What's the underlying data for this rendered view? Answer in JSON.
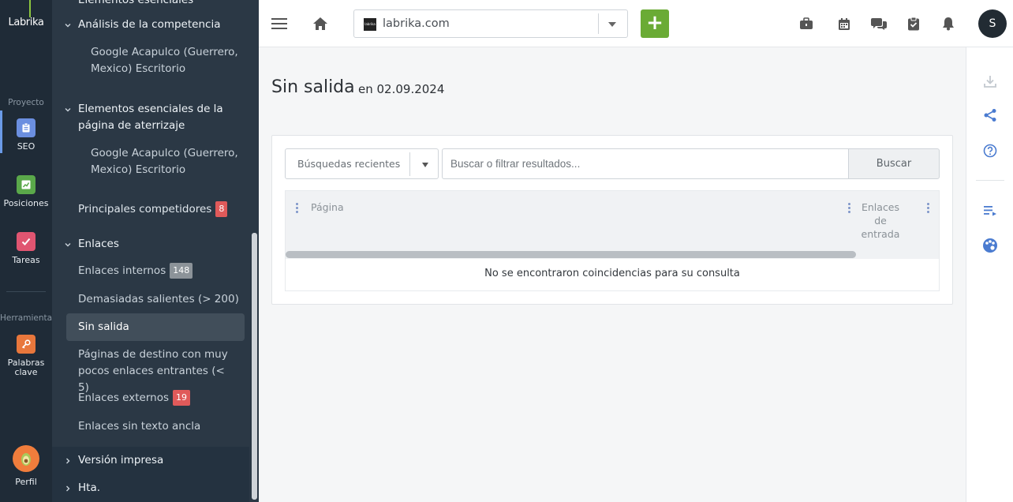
{
  "rail": {
    "logo": "Labrika",
    "section_project": "Proyecto",
    "section_tools": "Herramientas",
    "items": [
      {
        "label": "SEO",
        "icon": "clipboard-icon",
        "color": "#6b8fe0"
      },
      {
        "label": "Posiciones",
        "icon": "chart-icon",
        "color": "#5aa84a"
      },
      {
        "label": "Tareas",
        "icon": "check-icon",
        "color": "#e05571"
      },
      {
        "label": "Palabras clave",
        "icon": "key-icon",
        "color": "#e8773c"
      }
    ],
    "profile_label": "Perfil"
  },
  "sidebar": {
    "top_cut": "Elementos esenciales",
    "competencia": {
      "label": "Análisis de la competencia",
      "sub": "Google Acapulco (Guerrero, Mexico) Escritorio"
    },
    "aterrizaje": {
      "label": "Elementos esenciales de la página de aterrizaje",
      "sub": "Google Acapulco (Guerrero, Mexico) Escritorio"
    },
    "competidores": {
      "label": "Principales competidores",
      "badge": "8"
    },
    "enlaces": {
      "label": "Enlaces",
      "internos": {
        "label": "Enlaces internos",
        "badge": "148"
      },
      "salientes": "Demasiadas salientes (> 200)",
      "sin_salida": "Sin salida",
      "pocos": "Páginas de destino con muy pocos enlaces entrantes (< 5)",
      "externos": {
        "label": "Enlaces externos",
        "badge": "19"
      },
      "sin_ancla": "Enlaces sin texto ancla"
    },
    "version_impresa": "Versión impresa",
    "hta": "Hta."
  },
  "topbar": {
    "site": "labrika.com",
    "favicon_text": "labrika",
    "add_label": "+",
    "avatar": "S"
  },
  "main": {
    "title": "Sin salida",
    "date": "en 02.09.2024",
    "recent_searches": "Búsquedas recientes",
    "search_placeholder": "Buscar o filtrar resultados...",
    "search_button": "Buscar",
    "columns": [
      "Página",
      "Enlaces de entrada"
    ],
    "empty_message": "No se encontraron coincidencias para su consulta"
  },
  "colors": {
    "rail_bg": "#1f2b37",
    "sidebar_bg": "#2b3845",
    "accent_green": "#6aab35",
    "badge_red": "#e05a5a",
    "icon_blue": "#4a7bd0"
  }
}
